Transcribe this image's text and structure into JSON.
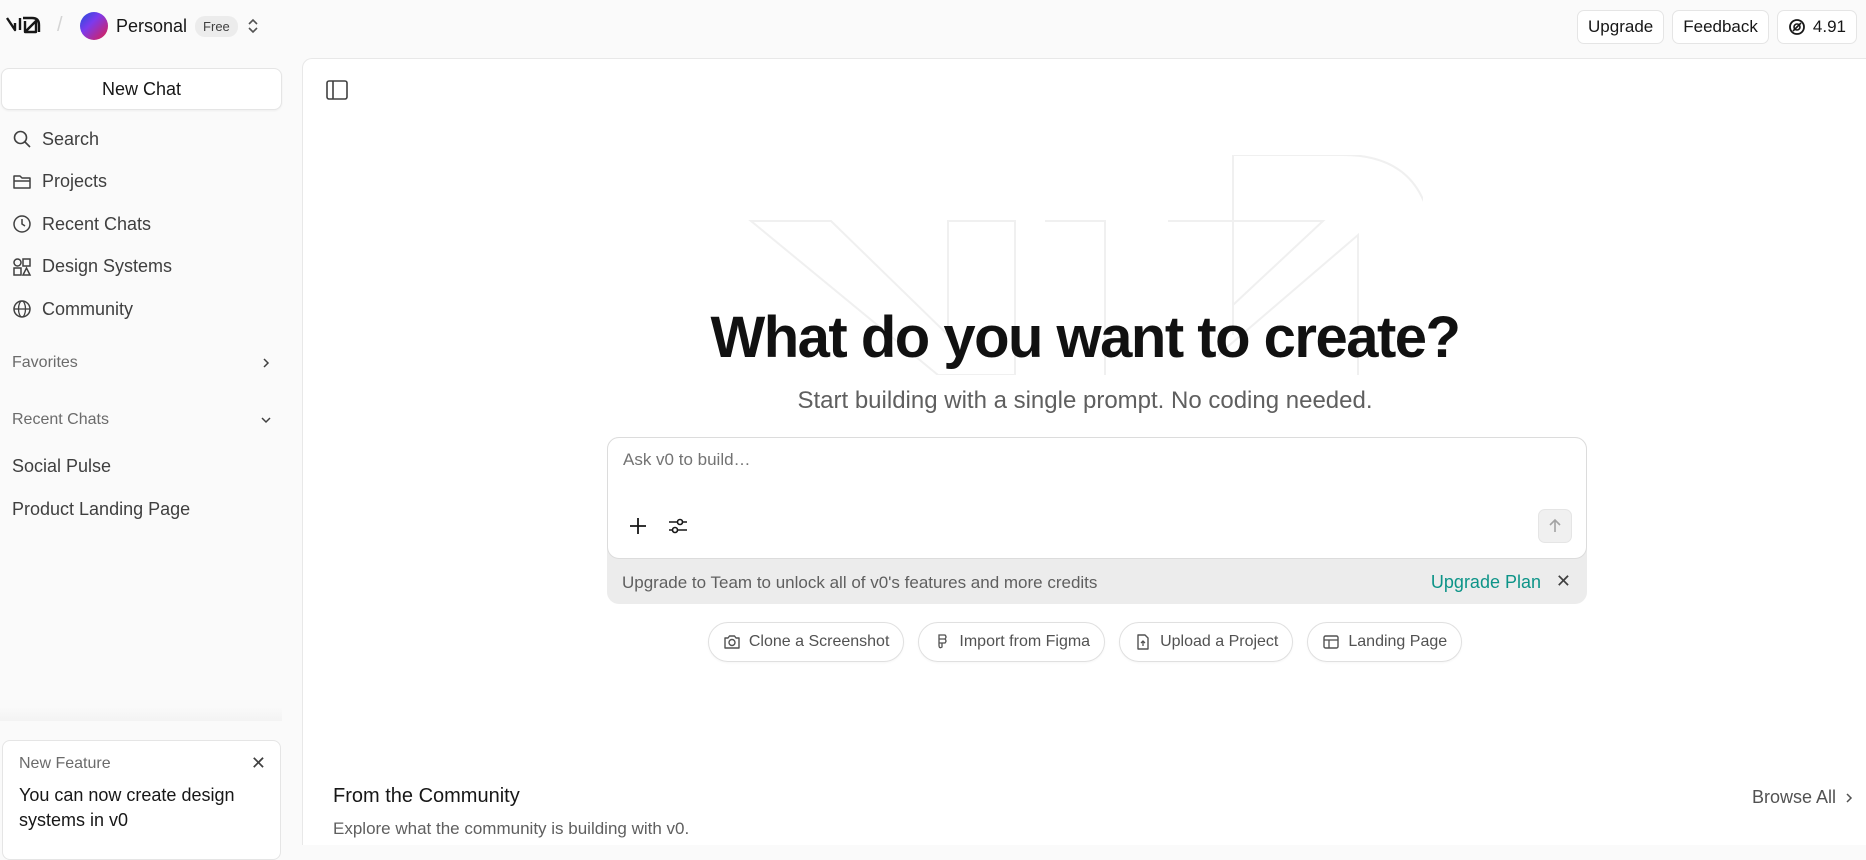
{
  "topbar": {
    "account_name": "Personal",
    "plan_badge": "Free",
    "upgrade_label": "Upgrade",
    "feedback_label": "Feedback",
    "credits": "4.91"
  },
  "sidebar": {
    "new_chat_label": "New Chat",
    "nav": [
      {
        "label": "Search",
        "icon": "search-icon"
      },
      {
        "label": "Projects",
        "icon": "folder-icon"
      },
      {
        "label": "Recent Chats",
        "icon": "clock-icon"
      },
      {
        "label": "Design Systems",
        "icon": "shapes-icon"
      },
      {
        "label": "Community",
        "icon": "globe-icon"
      }
    ],
    "favorites_label": "Favorites",
    "recent_label": "Recent Chats",
    "recent_items": [
      "Social Pulse",
      "Product Landing Page"
    ],
    "feature_card": {
      "title": "New Feature",
      "text": "You can now create design systems in v0"
    }
  },
  "main": {
    "headline": "What do you want to create?",
    "subline": "Start building with a single prompt. No coding needed.",
    "prompt_placeholder": "Ask v0 to build…",
    "upgrade_text": "Upgrade to Team to unlock all of v0's features and more credits",
    "upgrade_link": "Upgrade Plan",
    "chips": [
      {
        "label": "Clone a Screenshot",
        "icon": "camera-icon"
      },
      {
        "label": "Import from Figma",
        "icon": "figma-icon"
      },
      {
        "label": "Upload a Project",
        "icon": "file-upload-icon"
      },
      {
        "label": "Landing Page",
        "icon": "layout-icon"
      }
    ],
    "community_title": "From the Community",
    "community_sub": "Explore what the community is building with v0.",
    "browse_all": "Browse All"
  },
  "colors": {
    "accent_link": "#0d9488",
    "background": "#fafafa"
  }
}
